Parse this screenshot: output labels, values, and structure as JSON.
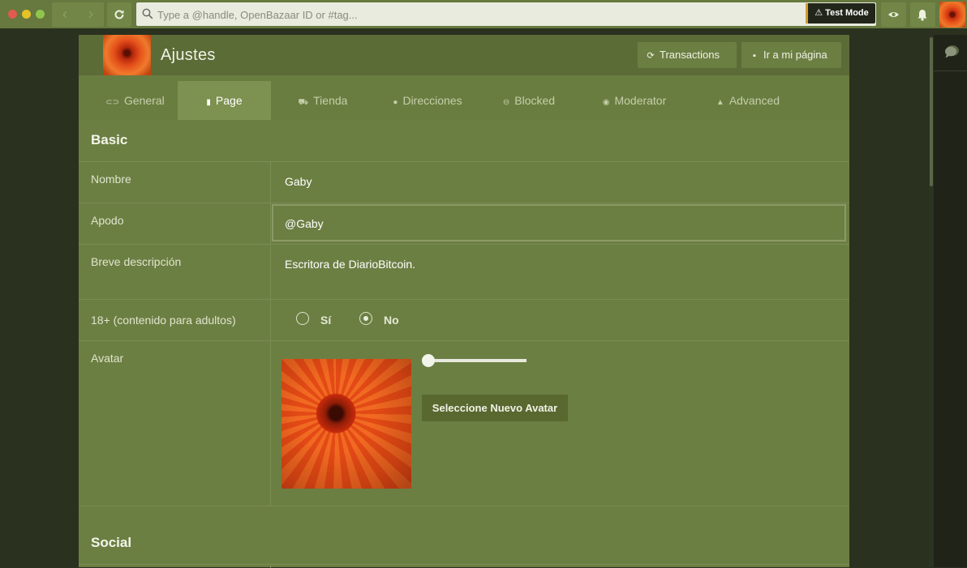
{
  "browser": {
    "search_placeholder": "Type a @handle, OpenBazaar ID or #tag...",
    "test_mode_label": "Test Mode",
    "back_icon": "chevron-left-icon",
    "forward_icon": "chevron-right-icon"
  },
  "header": {
    "title": "Ajustes",
    "transactions_label": "Transactions",
    "my_page_label": "Ir a mi página"
  },
  "tabs": [
    {
      "label": "General",
      "icon": "link-icon"
    },
    {
      "label": "Page",
      "icon": "page-icon",
      "active": true
    },
    {
      "label": "Tienda",
      "icon": "cart-icon"
    },
    {
      "label": "Direcciones",
      "icon": "map-pin-icon"
    },
    {
      "label": "Blocked",
      "icon": "blocked-icon"
    },
    {
      "label": "Moderator",
      "icon": "compass-icon"
    },
    {
      "label": "Advanced",
      "icon": "flask-icon"
    }
  ],
  "basic": {
    "section_title": "Basic",
    "name_label": "Nombre",
    "name_value": "Gaby",
    "handle_label": "Apodo",
    "handle_value": "@Gaby",
    "description_label": "Breve descripción",
    "description_value": "Escritora de DiarioBitcoin.",
    "nsfw_label": "18+ (contenido para adultos)",
    "nsfw_yes": "Sí",
    "nsfw_no": "No",
    "nsfw_selected": "No",
    "avatar_label": "Avatar",
    "avatar_zoom": 0,
    "select_avatar_label": "Seleccione Nuevo Avatar"
  },
  "social": {
    "section_title": "Social"
  },
  "colors": {
    "topbar": "#67793e",
    "panel": "#6c7f43",
    "header": "#5c6c37",
    "test_mode_accent": "#d39b35"
  }
}
